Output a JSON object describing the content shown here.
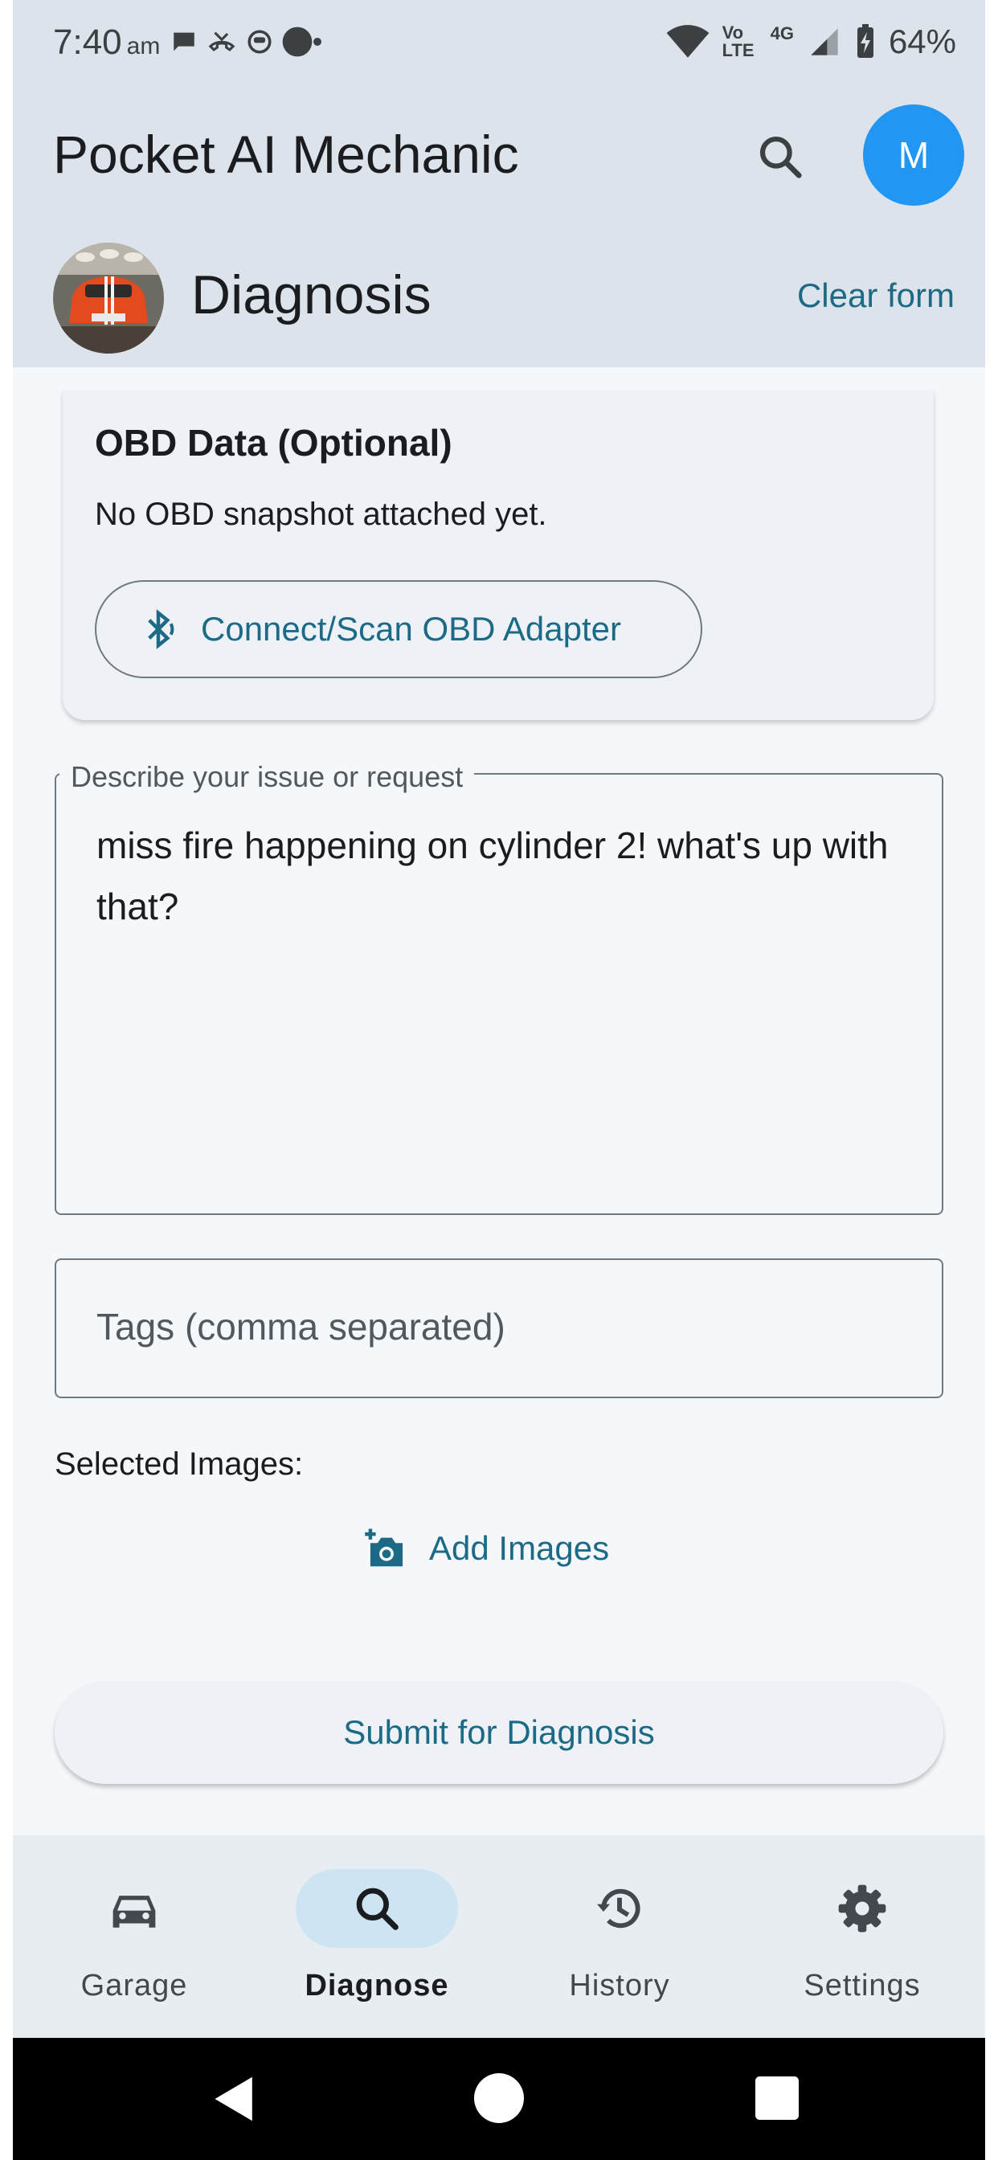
{
  "status_bar": {
    "time": "7:40",
    "ampm": "am",
    "network": "4G",
    "volte": "Vo LTE",
    "battery": "64%"
  },
  "app_bar": {
    "title": "Pocket AI Mechanic",
    "avatar_initial": "M"
  },
  "sub_header": {
    "title": "Diagnosis",
    "clear_label": "Clear form"
  },
  "obd_card": {
    "title": "OBD Data (Optional)",
    "status_text": "No OBD snapshot attached yet.",
    "connect_label": "Connect/Scan OBD Adapter"
  },
  "issue_field": {
    "label": "Describe your issue or request",
    "value": "miss fire happening on cylinder 2!  what's up with that?"
  },
  "tags_field": {
    "placeholder": "Tags (comma separated)"
  },
  "images": {
    "label": "Selected Images:",
    "add_label": "Add Images"
  },
  "submit": {
    "label": "Submit for Diagnosis"
  },
  "bottom_nav": {
    "items": [
      {
        "label": "Garage",
        "icon": "car-icon"
      },
      {
        "label": "Diagnose",
        "icon": "search-icon",
        "active": true
      },
      {
        "label": "History",
        "icon": "history-icon"
      },
      {
        "label": "Settings",
        "icon": "gear-icon"
      }
    ]
  },
  "colors": {
    "accent": "#1c6a86",
    "avatar": "#2196f3",
    "header_bg": "#dde3ea",
    "active_pill": "#cde5f3"
  }
}
